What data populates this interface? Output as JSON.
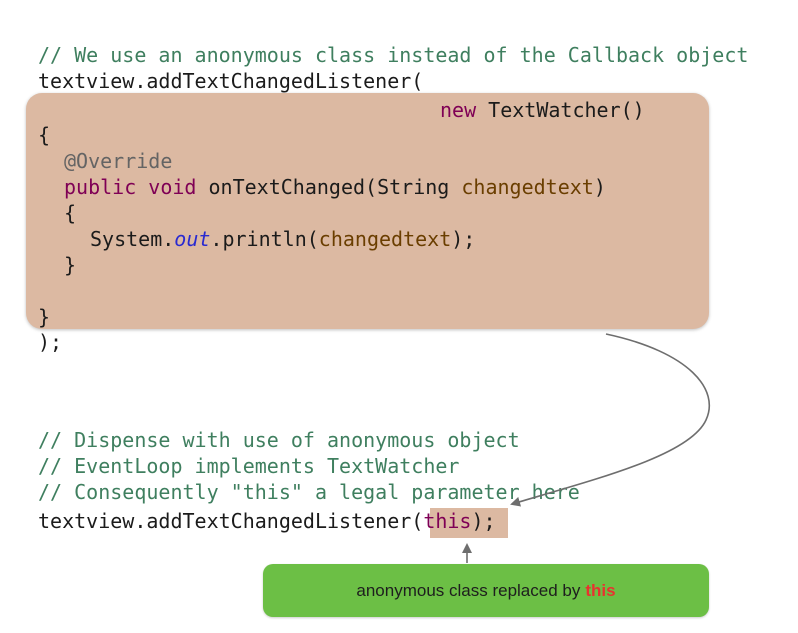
{
  "code_top": {
    "comment": "// We use an anonymous class instead of the Callback object",
    "call_open": "textview.addTextChangedListener(",
    "new_keyword": "new",
    "new_class": " TextWatcher()",
    "brace_open": "{",
    "annotation": "@Override",
    "kw_public": "public",
    "kw_void": "void",
    "method_sig": " onTextChanged(String ",
    "param_name": "changedtext",
    "sig_close": ")",
    "inner_brace_open": "{",
    "system": "System.",
    "out": "out",
    "println": ".println(",
    "println_arg": "changedtext",
    "println_close": ");",
    "inner_brace_close": "}",
    "brace_close": "}",
    "call_close": ");"
  },
  "code_bottom": {
    "comment1": "// Dispense with use of anonymous object",
    "comment2": "// EventLoop implements TextWatcher",
    "comment3": "// Consequently \"this\" a legal parameter here",
    "call_open": "textview.addTextChangedListener(",
    "this_keyword": "this",
    "call_close": ");"
  },
  "callout": {
    "text": "anonymous class replaced by",
    "highlight": "this"
  },
  "colors": {
    "box_fill": "#dcb9a2",
    "callout_fill": "#6cbf45",
    "highlight_text": "#e8332f",
    "comment": "#3f7f5f",
    "keyword": "#7f0055"
  }
}
